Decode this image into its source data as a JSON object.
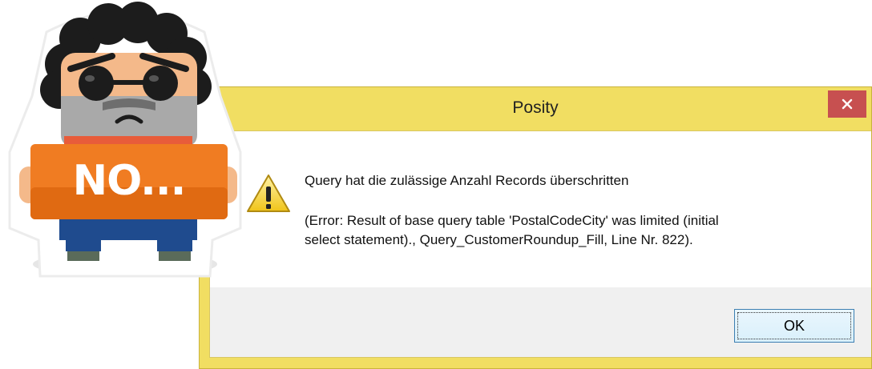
{
  "dialog": {
    "title": "Posity",
    "close_glyph": "×",
    "icon": "warning-icon",
    "message": "Query hat die zulässige Anzahl Records überschritten",
    "detail_line1": "(Error: Result of base query table 'PostalCodeCity' was limited (initial",
    "detail_line2": "select statement)., Query_CustomerRoundup_Fill, Line Nr. 822).",
    "ok_label": "OK",
    "colors": {
      "frame": "#f1de62",
      "close": "#c75050",
      "button_border": "#3c7fb1"
    }
  },
  "sticker": {
    "sign_text": "NO...",
    "colors": {
      "sign": "#f07c22",
      "hair": "#1c1c1c",
      "skin": "#f4b98a",
      "beard": "#a9a9a9"
    }
  }
}
